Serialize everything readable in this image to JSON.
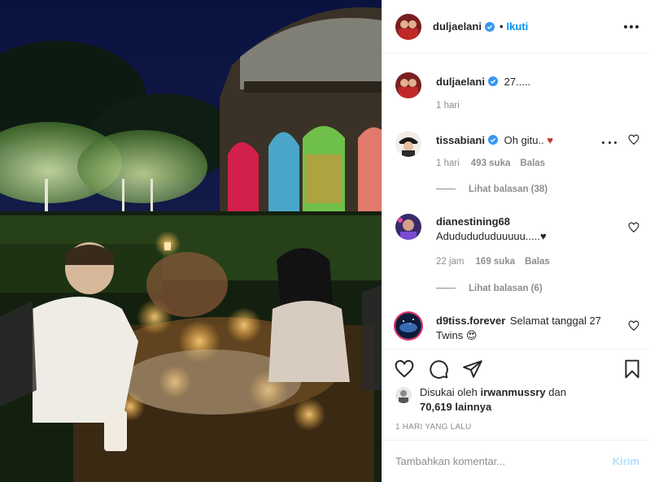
{
  "post": {
    "author": "duljaelani",
    "verified": true,
    "follow_label": "Ikuti",
    "separator": "•",
    "more_icon": "more-horizontal-icon"
  },
  "caption": {
    "username": "duljaelani",
    "text": "27.....",
    "time": "1 hari"
  },
  "comments": [
    {
      "username": "tissabiani",
      "verified": true,
      "text": "Oh gitu..",
      "emoji": "♥",
      "time": "1 hari",
      "likes": "493 suka",
      "reply_label": "Balas",
      "view_replies": "Lihat balasan (38)"
    },
    {
      "username": "dianestining68",
      "verified": false,
      "text": "Adududududuuuuu.....♥",
      "time": "22 jam",
      "likes": "169 suka",
      "reply_label": "Balas",
      "view_replies": "Lihat balasan (6)"
    },
    {
      "username": "d9tiss.forever",
      "verified": false,
      "text": "Selamat tanggal 27 Twins 😍"
    }
  ],
  "actions": {
    "like_icon": "heart-icon",
    "comment_icon": "comment-icon",
    "share_icon": "share-icon",
    "save_icon": "bookmark-icon"
  },
  "likes": {
    "prefix": "Disukai oleh",
    "user": "irwanmussry",
    "conj": "dan",
    "count": "70,619 lainnya"
  },
  "date": "1 HARI YANG LALU",
  "add_comment": {
    "placeholder": "Tambahkan komentar...",
    "post_label": "Kirim"
  },
  "colors": {
    "accent": "#0095f6",
    "post_disabled": "#b2dffc",
    "muted": "#8e8e8e",
    "text": "#262626",
    "heart_red": "#c0392b"
  }
}
